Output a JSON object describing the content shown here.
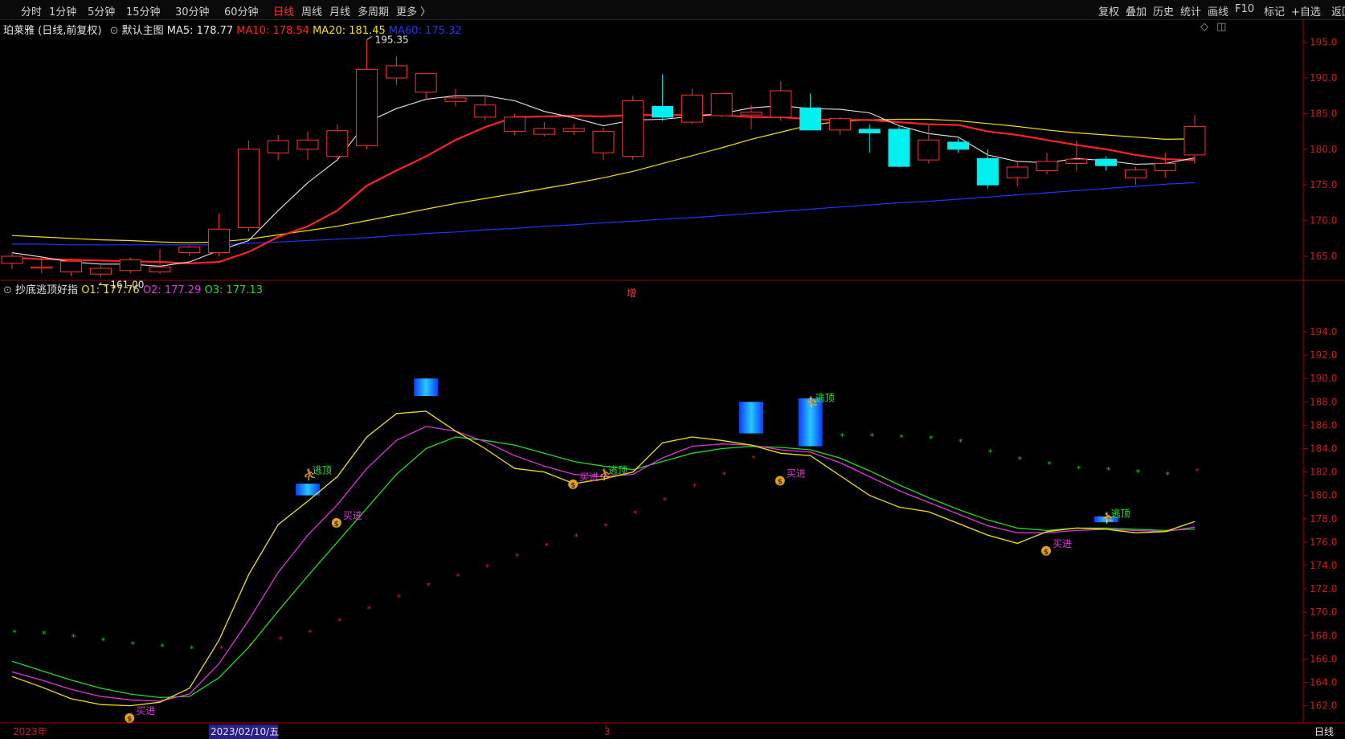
{
  "toolbar": {
    "periods": [
      "分时",
      "1分钟",
      "5分钟",
      "15分钟",
      "30分钟",
      "60分钟",
      "日线",
      "周线",
      "月线",
      "多周期",
      "更多 〉"
    ],
    "active_period": "日线",
    "right_buttons": [
      "复权",
      "叠加",
      "历史",
      "统计",
      "画线",
      "F10",
      "标记",
      "+自选",
      "返回"
    ]
  },
  "main_panel": {
    "stock_title": "珀莱雅 (日线,前复权)",
    "template": "默认主图",
    "ma": [
      {
        "label": "MA5: 178.77",
        "color": "#e6e6e6"
      },
      {
        "label": "MA10: 178.54",
        "color": "#ff2222"
      },
      {
        "label": "MA20: 181.45",
        "color": "#f2e200"
      },
      {
        "label": "MA60: 175.32",
        "color": "#2233ff"
      }
    ],
    "high_label": "195.35",
    "low_label": "161.00",
    "center_mark": "增",
    "y_ticks": [
      "195.0",
      "190.0",
      "185.0",
      "180.0",
      "175.0",
      "170.0",
      "165.0"
    ]
  },
  "indicator_panel": {
    "name": "抄底逃顶好指",
    "values": [
      {
        "label": "O1: 177.76",
        "color": "#f2e200"
      },
      {
        "label": "O2: 177.29",
        "color": "#e033e0"
      },
      {
        "label": "O3: 177.13",
        "color": "#22dd22"
      }
    ],
    "y_ticks": [
      "194.0",
      "192.0",
      "190.0",
      "188.0",
      "186.0",
      "184.0",
      "182.0",
      "180.0",
      "178.0",
      "176.0",
      "174.0",
      "172.0",
      "170.0",
      "168.0",
      "166.0",
      "164.0",
      "162.0"
    ],
    "buy_label": "买进",
    "sell_label": "逃顶"
  },
  "time_axis": {
    "year_label": "2023年",
    "cursor_date": "2023/02/10/五",
    "month_label": "3",
    "period_label": "日线"
  },
  "chart_data": {
    "type": "candlestick",
    "candles": [
      {
        "o": 164.0,
        "h": 165.5,
        "l": 163.2,
        "c": 165.0
      },
      {
        "o": 163.5,
        "h": 164.8,
        "l": 162.6,
        "c": 163.5
      },
      {
        "o": 162.8,
        "h": 164.5,
        "l": 162.2,
        "c": 164.3
      },
      {
        "o": 162.5,
        "h": 163.7,
        "l": 162.0,
        "c": 163.3
      },
      {
        "o": 163.0,
        "h": 164.8,
        "l": 162.6,
        "c": 164.5
      },
      {
        "o": 162.8,
        "h": 166.0,
        "l": 162.5,
        "c": 163.5
      },
      {
        "o": 165.5,
        "h": 166.5,
        "l": 165.0,
        "c": 166.3
      },
      {
        "o": 165.5,
        "h": 171.0,
        "l": 165.0,
        "c": 168.8
      },
      {
        "o": 169.0,
        "h": 181.2,
        "l": 168.5,
        "c": 180.0
      },
      {
        "o": 179.5,
        "h": 182.0,
        "l": 178.5,
        "c": 181.2
      },
      {
        "o": 180.0,
        "h": 182.5,
        "l": 178.5,
        "c": 181.3
      },
      {
        "o": 179.0,
        "h": 183.5,
        "l": 178.5,
        "c": 182.6
      },
      {
        "o": 180.5,
        "h": 195.35,
        "l": 180.0,
        "c": 191.2
      },
      {
        "o": 190.0,
        "h": 193.0,
        "l": 189.0,
        "c": 191.7
      },
      {
        "o": 188.0,
        "h": 190.0,
        "l": 187.0,
        "c": 190.6
      },
      {
        "o": 186.7,
        "h": 188.5,
        "l": 186.0,
        "c": 187.2
      },
      {
        "o": 184.5,
        "h": 187.5,
        "l": 184.0,
        "c": 186.2
      },
      {
        "o": 182.5,
        "h": 185.0,
        "l": 182.0,
        "c": 184.5
      },
      {
        "o": 182.1,
        "h": 183.8,
        "l": 181.8,
        "c": 182.9
      },
      {
        "o": 182.5,
        "h": 183.5,
        "l": 182.0,
        "c": 182.9
      },
      {
        "o": 179.5,
        "h": 183.0,
        "l": 178.5,
        "c": 182.5
      },
      {
        "o": 179.0,
        "h": 187.5,
        "l": 178.5,
        "c": 186.8
      },
      {
        "o": 186.0,
        "h": 190.5,
        "l": 184.0,
        "c": 184.5
      },
      {
        "o": 183.8,
        "h": 188.5,
        "l": 183.5,
        "c": 187.6
      },
      {
        "o": 184.7,
        "h": 187.5,
        "l": 184.5,
        "c": 187.8
      },
      {
        "o": 184.8,
        "h": 186.2,
        "l": 182.8,
        "c": 185.2
      },
      {
        "o": 184.5,
        "h": 189.5,
        "l": 184.0,
        "c": 188.2
      },
      {
        "o": 185.8,
        "h": 187.8,
        "l": 185.0,
        "c": 182.7
      },
      {
        "o": 182.7,
        "h": 184.5,
        "l": 182.0,
        "c": 184.3
      },
      {
        "o": 182.8,
        "h": 183.5,
        "l": 179.5,
        "c": 182.3
      },
      {
        "o": 182.8,
        "h": 183.2,
        "l": 177.5,
        "c": 177.6
      },
      {
        "o": 178.5,
        "h": 183.5,
        "l": 178.0,
        "c": 181.3
      },
      {
        "o": 181.0,
        "h": 181.5,
        "l": 179.5,
        "c": 180.0
      },
      {
        "o": 178.7,
        "h": 180.0,
        "l": 174.5,
        "c": 175.0
      },
      {
        "o": 176.0,
        "h": 178.2,
        "l": 174.8,
        "c": 177.5
      },
      {
        "o": 177.0,
        "h": 179.5,
        "l": 176.5,
        "c": 178.3
      },
      {
        "o": 178.0,
        "h": 181.2,
        "l": 177.0,
        "c": 178.6
      },
      {
        "o": 178.6,
        "h": 179.0,
        "l": 177.0,
        "c": 177.7
      },
      {
        "o": 176.0,
        "h": 177.5,
        "l": 175.0,
        "c": 177.1
      },
      {
        "o": 177.0,
        "h": 179.5,
        "l": 176.0,
        "c": 178.0
      },
      {
        "o": 179.2,
        "h": 184.8,
        "l": 178.0,
        "c": 183.2
      }
    ],
    "ma5": [
      165.5,
      164.9,
      164.2,
      163.9,
      163.9,
      163.6,
      164.2,
      165.8,
      167.2,
      171.4,
      175.3,
      178.5,
      183.8,
      185.7,
      187.0,
      187.5,
      187.5,
      186.8,
      185.3,
      184.4,
      183.3,
      184.1,
      184.2,
      184.6,
      185.0,
      185.8,
      186.1,
      185.7,
      185.6,
      185.1,
      183.3,
      182.2,
      181.7,
      179.2,
      178.3,
      178.1,
      178.7,
      178.4,
      177.9,
      178.0,
      178.8
    ],
    "ma10": [
      164.8,
      164.6,
      164.5,
      164.4,
      164.3,
      164.2,
      164.0,
      164.2,
      165.6,
      167.7,
      169.2,
      171.4,
      174.9,
      177.0,
      179.0,
      181.3,
      183.1,
      184.5,
      184.6,
      184.7,
      184.6,
      184.8,
      184.8,
      184.8,
      184.8,
      184.5,
      184.5,
      184.2,
      184.1,
      184.1,
      183.8,
      183.5,
      183.4,
      182.5,
      182.0,
      181.3,
      180.6,
      180.0,
      179.2,
      178.6,
      178.5
    ],
    "ma20": [
      167.9,
      167.7,
      167.5,
      167.3,
      167.2,
      167.0,
      166.9,
      167.0,
      167.4,
      168.0,
      168.6,
      169.2,
      170.0,
      170.8,
      171.6,
      172.4,
      173.1,
      173.8,
      174.5,
      175.2,
      176.0,
      176.9,
      178.0,
      179.1,
      180.2,
      181.4,
      182.4,
      183.4,
      183.9,
      184.1,
      184.2,
      184.2,
      184.0,
      183.6,
      183.2,
      182.7,
      182.3,
      182.0,
      181.7,
      181.4,
      181.45
    ],
    "ma60": [
      166.7,
      166.7,
      166.6,
      166.6,
      166.6,
      166.6,
      166.6,
      166.6,
      166.8,
      167.0,
      167.2,
      167.4,
      167.6,
      167.9,
      168.2,
      168.4,
      168.7,
      168.9,
      169.2,
      169.4,
      169.7,
      169.9,
      170.2,
      170.4,
      170.7,
      171.0,
      171.3,
      171.6,
      171.9,
      172.2,
      172.5,
      172.7,
      173.0,
      173.3,
      173.6,
      173.9,
      174.2,
      174.5,
      174.8,
      175.1,
      175.32
    ],
    "o1": [
      164.5,
      163.6,
      162.6,
      162.1,
      162.0,
      162.3,
      163.5,
      167.6,
      173.2,
      177.5,
      179.5,
      181.6,
      185.0,
      187.0,
      187.2,
      185.5,
      184.0,
      182.3,
      182.0,
      181.0,
      181.4,
      182.0,
      184.5,
      185.0,
      184.7,
      184.3,
      183.6,
      183.4,
      181.7,
      180.0,
      179.0,
      178.6,
      177.6,
      176.6,
      175.9,
      176.9,
      177.2,
      177.1,
      176.8,
      176.9,
      177.76
    ],
    "o2": [
      164.9,
      164.2,
      163.4,
      162.8,
      162.5,
      162.4,
      163.0,
      165.6,
      169.3,
      173.4,
      176.6,
      179.2,
      182.3,
      184.7,
      185.9,
      185.5,
      184.6,
      183.4,
      182.5,
      181.8,
      181.6,
      181.8,
      183.2,
      184.2,
      184.4,
      184.3,
      183.9,
      183.7,
      182.8,
      181.6,
      180.4,
      179.4,
      178.4,
      177.4,
      176.8,
      176.8,
      177.0,
      177.1,
      177.0,
      176.9,
      177.29
    ],
    "o3": [
      165.8,
      165.0,
      164.2,
      163.5,
      163.0,
      162.7,
      162.8,
      164.4,
      167.0,
      170.1,
      173.1,
      176.0,
      178.9,
      181.8,
      184.0,
      185.0,
      184.7,
      184.3,
      183.6,
      182.9,
      182.5,
      182.2,
      182.9,
      183.6,
      184.0,
      184.2,
      184.1,
      183.9,
      183.2,
      182.1,
      180.9,
      179.8,
      178.8,
      177.9,
      177.2,
      177.0,
      177.2,
      177.2,
      177.1,
      177.0,
      177.13
    ],
    "green_dots": [
      [
        0,
        168.0
      ],
      [
        1,
        167.9
      ],
      [
        2,
        167.6
      ],
      [
        3,
        167.3
      ],
      [
        4,
        167.0
      ],
      [
        5,
        166.8
      ],
      [
        6,
        166.6
      ],
      [
        28,
        184.8
      ],
      [
        29,
        184.8
      ],
      [
        30,
        184.7
      ],
      [
        31,
        184.6
      ],
      [
        32,
        184.3
      ],
      [
        33,
        183.4
      ],
      [
        34,
        182.8
      ],
      [
        35,
        182.4
      ],
      [
        36,
        182.0
      ],
      [
        37,
        181.9
      ],
      [
        38,
        181.7
      ],
      [
        39,
        181.5
      ]
    ],
    "red_dots": [
      [
        7,
        166.6
      ],
      [
        8,
        166.9
      ],
      [
        9,
        167.4
      ],
      [
        10,
        168.0
      ],
      [
        11,
        169.0
      ],
      [
        12,
        170.0
      ],
      [
        13,
        171.0
      ],
      [
        14,
        172.0
      ],
      [
        15,
        172.8
      ],
      [
        16,
        173.6
      ],
      [
        17,
        174.5
      ],
      [
        18,
        175.4
      ],
      [
        19,
        176.2
      ],
      [
        20,
        177.1
      ],
      [
        21,
        178.2
      ],
      [
        22,
        179.3
      ],
      [
        23,
        180.5
      ],
      [
        24,
        181.5
      ],
      [
        25,
        182.9
      ],
      [
        40,
        181.8
      ]
    ],
    "blue_bars": [
      [
        10,
        181.0,
        180.0
      ],
      [
        14,
        190.0,
        188.5
      ],
      [
        25,
        188.0,
        185.3
      ],
      [
        27,
        188.3,
        184.2
      ],
      [
        37,
        178.2,
        177.7
      ]
    ],
    "sell_signals": [
      [
        10,
        182.0
      ],
      [
        20,
        182.0
      ],
      [
        27,
        188.2
      ],
      [
        37,
        178.3
      ]
    ],
    "buy_signals": [
      [
        4,
        161.5
      ],
      [
        11,
        178.2
      ],
      [
        19,
        181.5
      ],
      [
        26,
        181.8
      ],
      [
        35,
        175.8
      ]
    ]
  }
}
